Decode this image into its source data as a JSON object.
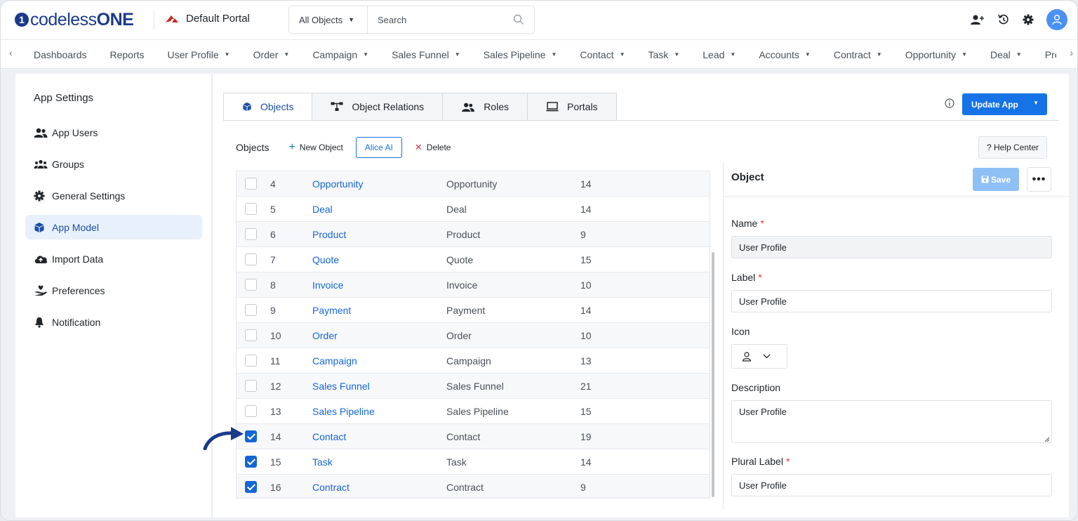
{
  "app": {
    "logo_prefix": "codeless",
    "logo_suffix": "ONE",
    "portal_name": "Default Portal"
  },
  "search": {
    "scope": "All Objects",
    "placeholder": "Search"
  },
  "nav": {
    "items": [
      {
        "label": "Dashboards",
        "dropdown": false
      },
      {
        "label": "Reports",
        "dropdown": false
      },
      {
        "label": "User Profile",
        "dropdown": true
      },
      {
        "label": "Order",
        "dropdown": true
      },
      {
        "label": "Campaign",
        "dropdown": true
      },
      {
        "label": "Sales Funnel",
        "dropdown": true
      },
      {
        "label": "Sales Pipeline",
        "dropdown": true
      },
      {
        "label": "Contact",
        "dropdown": true
      },
      {
        "label": "Task",
        "dropdown": true
      },
      {
        "label": "Lead",
        "dropdown": true
      },
      {
        "label": "Accounts",
        "dropdown": true
      },
      {
        "label": "Contract",
        "dropdown": true
      },
      {
        "label": "Opportunity",
        "dropdown": true
      },
      {
        "label": "Deal",
        "dropdown": true
      },
      {
        "label": "Pro",
        "dropdown": false
      }
    ]
  },
  "sidebar": {
    "title": "App Settings",
    "items": [
      {
        "label": "App Users",
        "icon": "users-icon",
        "active": false
      },
      {
        "label": "Groups",
        "icon": "group-icon",
        "active": false
      },
      {
        "label": "General Settings",
        "icon": "gear-icon",
        "active": false
      },
      {
        "label": "App Model",
        "icon": "cube-icon",
        "active": true
      },
      {
        "label": "Import Data",
        "icon": "cloud-upload-icon",
        "active": false
      },
      {
        "label": "Preferences",
        "icon": "hand-heart-icon",
        "active": false
      },
      {
        "label": "Notification",
        "icon": "bell-icon",
        "active": false
      }
    ]
  },
  "tabs": [
    {
      "label": "Objects",
      "active": true
    },
    {
      "label": "Object Relations",
      "active": false
    },
    {
      "label": "Roles",
      "active": false
    },
    {
      "label": "Portals",
      "active": false
    }
  ],
  "actions": {
    "update_app": "Update App",
    "help_center": "? Help Center"
  },
  "toolbar": {
    "label": "Objects",
    "new_object": "New Object",
    "alice_ai": "Alice AI",
    "delete": "Delete"
  },
  "objects": [
    {
      "num": "4",
      "name": "Opportunity",
      "label": "Opportunity",
      "count": "14",
      "checked": false
    },
    {
      "num": "5",
      "name": "Deal",
      "label": "Deal",
      "count": "14",
      "checked": false
    },
    {
      "num": "6",
      "name": "Product",
      "label": "Product",
      "count": "9",
      "checked": false
    },
    {
      "num": "7",
      "name": "Quote",
      "label": "Quote",
      "count": "15",
      "checked": false
    },
    {
      "num": "8",
      "name": "Invoice",
      "label": "Invoice",
      "count": "10",
      "checked": false
    },
    {
      "num": "9",
      "name": "Payment",
      "label": "Payment",
      "count": "14",
      "checked": false
    },
    {
      "num": "10",
      "name": "Order",
      "label": "Order",
      "count": "10",
      "checked": false
    },
    {
      "num": "11",
      "name": "Campaign",
      "label": "Campaign",
      "count": "13",
      "checked": false
    },
    {
      "num": "12",
      "name": "Sales Funnel",
      "label": "Sales Funnel",
      "count": "21",
      "checked": false
    },
    {
      "num": "13",
      "name": "Sales Pipeline",
      "label": "Sales Pipeline",
      "count": "15",
      "checked": false
    },
    {
      "num": "14",
      "name": "Contact",
      "label": "Contact",
      "count": "19",
      "checked": true
    },
    {
      "num": "15",
      "name": "Task",
      "label": "Task",
      "count": "14",
      "checked": true
    },
    {
      "num": "16",
      "name": "Contract",
      "label": "Contract",
      "count": "9",
      "checked": true
    }
  ],
  "panel": {
    "title": "Object",
    "save": "Save",
    "more": "•••",
    "name_label": "Name",
    "name_value": "User Profile",
    "label_label": "Label",
    "label_value": "User Profile",
    "icon_label": "Icon",
    "description_label": "Description",
    "description_value": "User Profile",
    "plural_label": "Plural Label",
    "plural_value": "User Profile",
    "required_mark": "*"
  },
  "colors": {
    "brand": "#1b3a8c",
    "primary": "#1673e6",
    "link": "#1466d6",
    "danger": "#dc3545"
  }
}
